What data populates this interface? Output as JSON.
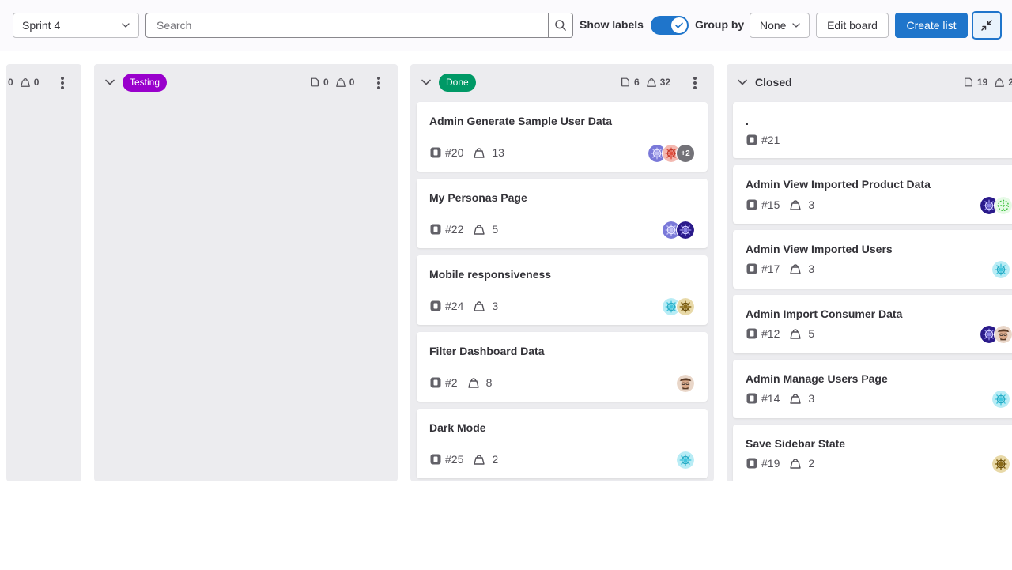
{
  "toolbar": {
    "sprint_value": "Sprint 4",
    "search_placeholder": "Search",
    "show_labels_label": "Show labels",
    "show_labels_on": true,
    "group_by_label": "Group by",
    "group_by_value": "None",
    "edit_board_label": "Edit board",
    "create_list_label": "Create list"
  },
  "lists": [
    {
      "id": "partial",
      "title": "",
      "issues": "0",
      "weight": "0"
    },
    {
      "id": "testing",
      "title": "Testing",
      "label_color": "#9900cc",
      "issues": "0",
      "weight": "0"
    },
    {
      "id": "done",
      "title": "Done",
      "label_color": "#009966",
      "issues": "6",
      "weight": "32"
    },
    {
      "id": "closed",
      "title": "Closed",
      "issues": "19",
      "weight": "2"
    }
  ],
  "done_cards": [
    {
      "title": "Admin Generate Sample User Data",
      "number": "#20",
      "weight": "13",
      "more_assignees": "+2"
    },
    {
      "title": "My Personas Page",
      "number": "#22",
      "weight": "5"
    },
    {
      "title": "Mobile responsiveness",
      "number": "#24",
      "weight": "3"
    },
    {
      "title": "Filter Dashboard Data",
      "number": "#2",
      "weight": "8"
    },
    {
      "title": "Dark Mode",
      "number": "#25",
      "weight": "2"
    }
  ],
  "closed_cards": [
    {
      "title": ".",
      "number": "#21"
    },
    {
      "title": "Admin View Imported Product Data",
      "number": "#15",
      "weight": "3"
    },
    {
      "title": "Admin View Imported Users",
      "number": "#17",
      "weight": "3"
    },
    {
      "title": "Admin Import Consumer Data",
      "number": "#12",
      "weight": "5"
    },
    {
      "title": "Admin Manage Users Page",
      "number": "#14",
      "weight": "3"
    },
    {
      "title": "Save Sidebar State",
      "number": "#19",
      "weight": "2"
    }
  ],
  "colors": {
    "accent": "#1f75cb",
    "list_bg": "#ececef"
  }
}
